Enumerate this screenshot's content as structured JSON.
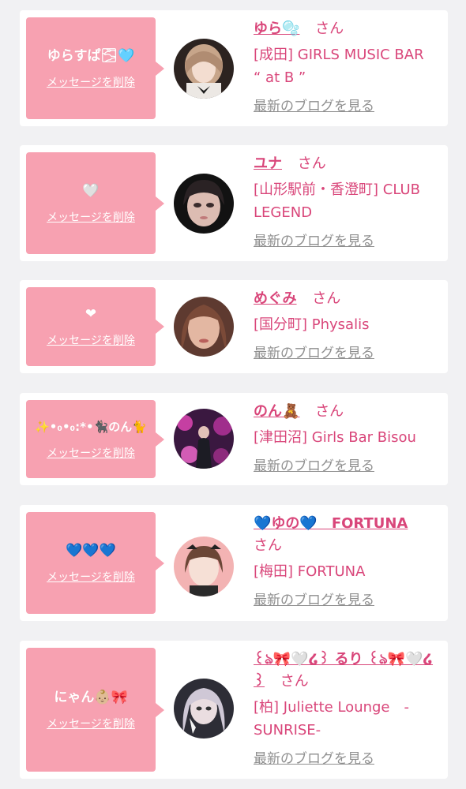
{
  "cards": [
    {
      "bubble_message": "ゆらすぱ🌫🩵",
      "delete_label": "メッセージを削除",
      "name": "ゆら🫧",
      "honorific": "さん",
      "store_lines": [
        "[成田] GIRLS MUSIC BAR",
        "“ at B ”"
      ],
      "blog_label": "最新のブログを見る"
    },
    {
      "bubble_message": "🤍",
      "delete_label": "メッセージを削除",
      "name": "ユナ",
      "honorific": "さん",
      "store_lines": [
        "[山形駅前・香澄町] CLUB",
        "LEGEND"
      ],
      "blog_label": "最新のブログを見る"
    },
    {
      "bubble_message": "❤",
      "delete_label": "メッセージを削除",
      "name": "めぐみ",
      "honorific": "さん",
      "store_lines": [
        "[国分町] Physalis"
      ],
      "blog_label": "最新のブログを見る"
    },
    {
      "bubble_message": "✨•₀•₀:*•🐈‍⬛のん🐈",
      "delete_label": "メッセージを削除",
      "name": "のん🧸",
      "honorific": "さん",
      "store_lines": [
        "[津田沼] Girls Bar Bisou"
      ],
      "blog_label": "最新のブログを見る"
    },
    {
      "bubble_message": "💙💙💙",
      "delete_label": "メッセージを削除",
      "name": "💙ゆの💙　FORTUNA",
      "honorific": "さん",
      "store_lines": [
        "[梅田] FORTUNA"
      ],
      "blog_label": "最新のブログを見る"
    },
    {
      "bubble_message": "にゃん👶🏼🎀",
      "delete_label": "メッセージを削除",
      "name": "꒰ঌ🎀🤍໒꒱ るり ꒰ঌ🎀🤍໒꒱",
      "honorific": "さん",
      "store_lines": [
        "[柏] Juliette Lounge　-",
        "SUNRISE-"
      ],
      "blog_label": "最新のブログを見る"
    }
  ],
  "colors": {
    "accent": "#d9467a",
    "bubble": "#f7a1b1",
    "background": "#f1f1f3",
    "muted": "#8f8f8f"
  }
}
